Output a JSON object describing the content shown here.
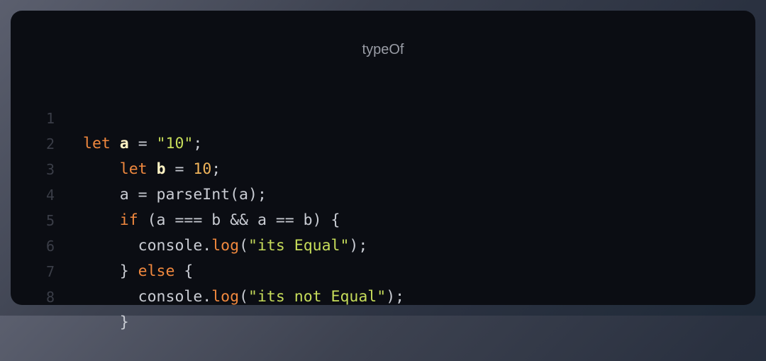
{
  "window": {
    "title": "typeOf"
  },
  "code": {
    "lines": [
      {
        "number": "1"
      },
      {
        "number": "2"
      },
      {
        "number": "3"
      },
      {
        "number": "4"
      },
      {
        "number": "5"
      },
      {
        "number": "6"
      },
      {
        "number": "7"
      },
      {
        "number": "8"
      }
    ],
    "tokens": {
      "l1": {
        "kw": "let",
        "var": "a",
        "op": " = ",
        "str": "\"10\"",
        "end": ";"
      },
      "l2": {
        "indent": "    ",
        "kw": "let",
        "var": "b",
        "op": " = ",
        "num": "10",
        "end": ";"
      },
      "l3": {
        "indent": "    ",
        "text": "a = parseInt(a);"
      },
      "l4": {
        "indent": "    ",
        "kw": "if",
        "text": " (a === b && a == b) {"
      },
      "l5": {
        "indent": "      ",
        "obj": "console.",
        "fn": "log",
        "open": "(",
        "str": "\"its Equal\"",
        "close": ");"
      },
      "l6": {
        "indent": "    ",
        "brace": "} ",
        "kw": "else",
        "text": " {"
      },
      "l7": {
        "indent": "      ",
        "obj": "console.",
        "fn": "log",
        "open": "(",
        "str": "\"its not Equal\"",
        "close": ");"
      },
      "l8": {
        "indent": "    ",
        "text": "}"
      }
    }
  },
  "colors": {
    "background_window": "#0b0d13",
    "keyword": "#f0883e",
    "string": "#c6dc5a",
    "number": "#f0b45a",
    "variable": "#fff3c4",
    "plain": "#c9ccd3",
    "line_number": "#3a3d47",
    "title": "#9a9da6"
  }
}
